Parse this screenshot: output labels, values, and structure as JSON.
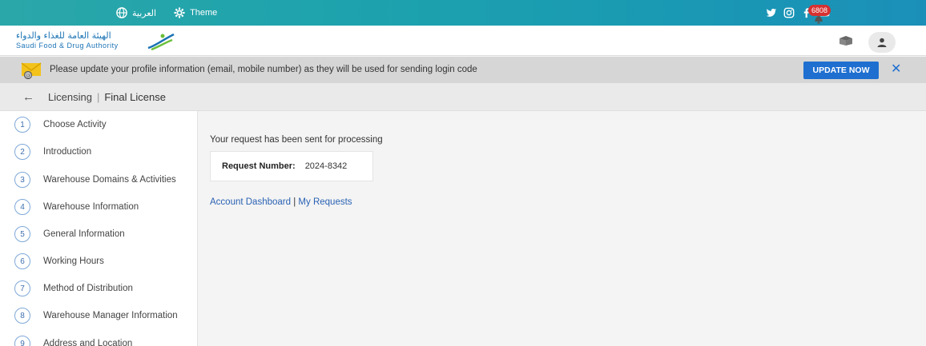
{
  "topbar": {
    "language_label": "العربية",
    "theme_label": "Theme",
    "social_icons": [
      "twitter-icon",
      "instagram-icon",
      "facebook-icon",
      "youtube-icon"
    ]
  },
  "header": {
    "logo_ar": "الهيئة العامة للغذاء والدواء",
    "logo_en": "Saudi Food & Drug Authority",
    "notification_count": "6808"
  },
  "alert": {
    "message": "Please update your profile information (email, mobile number) as they will be used for sending login code",
    "button_label": "UPDATE NOW",
    "close_label": "✕"
  },
  "breadcrumb": {
    "back": "←",
    "section": "Licensing",
    "separator": "|",
    "page": "Final License"
  },
  "steps": [
    {
      "num": "1",
      "label": "Choose Activity"
    },
    {
      "num": "2",
      "label": "Introduction"
    },
    {
      "num": "3",
      "label": "Warehouse Domains & Activities"
    },
    {
      "num": "4",
      "label": "Warehouse Information"
    },
    {
      "num": "5",
      "label": "General Information"
    },
    {
      "num": "6",
      "label": "Working Hours"
    },
    {
      "num": "7",
      "label": "Method of Distribution"
    },
    {
      "num": "8",
      "label": "Warehouse Manager Information"
    },
    {
      "num": "9",
      "label": "Address and Location"
    }
  ],
  "main": {
    "sent_message": "Your request has been sent for processing",
    "request_label": "Request Number:",
    "request_value": "2024-8342",
    "link_dashboard": "Account Dashboard",
    "link_separator": "|",
    "link_requests": "My Requests"
  },
  "colors": {
    "primary": "#1e6fd0",
    "topbar_start": "#2aa7a9",
    "badge": "#d63131"
  }
}
